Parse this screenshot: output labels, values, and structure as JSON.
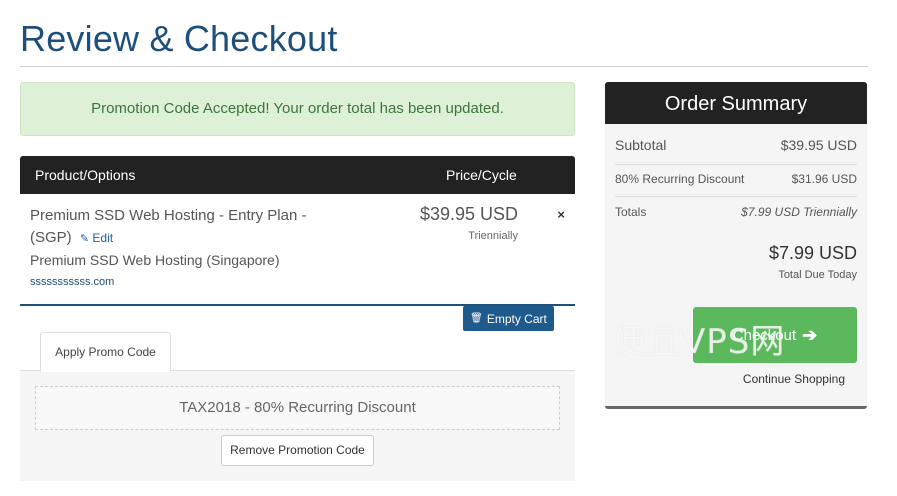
{
  "page": {
    "title": "Review & Checkout"
  },
  "alert": {
    "message": "Promotion Code Accepted! Your order total has been updated."
  },
  "cart": {
    "col_product": "Product/Options",
    "col_price": "Price/Cycle",
    "item": {
      "name": "Premium SSD Web Hosting - Entry Plan - (SGP)",
      "edit_label": "Edit",
      "description": "Premium SSD Web Hosting (Singapore)",
      "domain": "sssssssssss.com",
      "price": "$39.95 USD",
      "cycle": "Triennially",
      "remove_icon": "×"
    },
    "empty_cart_label": "Empty Cart"
  },
  "promo": {
    "tab_label": "Apply Promo Code",
    "applied_code": "TAX2018 - 80% Recurring Discount",
    "remove_label": "Remove Promotion Code"
  },
  "summary": {
    "title": "Order Summary",
    "subtotal_label": "Subtotal",
    "subtotal_value": "$39.95 USD",
    "discount_label": "80% Recurring Discount",
    "discount_value": "$31.96 USD",
    "totals_label": "Totals",
    "totals_value": "$7.99 USD Triennially",
    "total_due_amount": "$7.99 USD",
    "total_due_label": "Total Due Today",
    "checkout_label": "Checkout",
    "continue_label": "Continue Shopping"
  },
  "watermark": {
    "text": "便宜VPS网"
  },
  "icons": {
    "edit": "pencil-icon",
    "trash": "trash-icon",
    "remove": "close-icon",
    "checkout": "arrow-right-icon"
  },
  "colors": {
    "brand": "#1e4f7a",
    "success": "#5cb85c",
    "alert_bg": "#dff0d8",
    "header_bg": "#222222"
  }
}
